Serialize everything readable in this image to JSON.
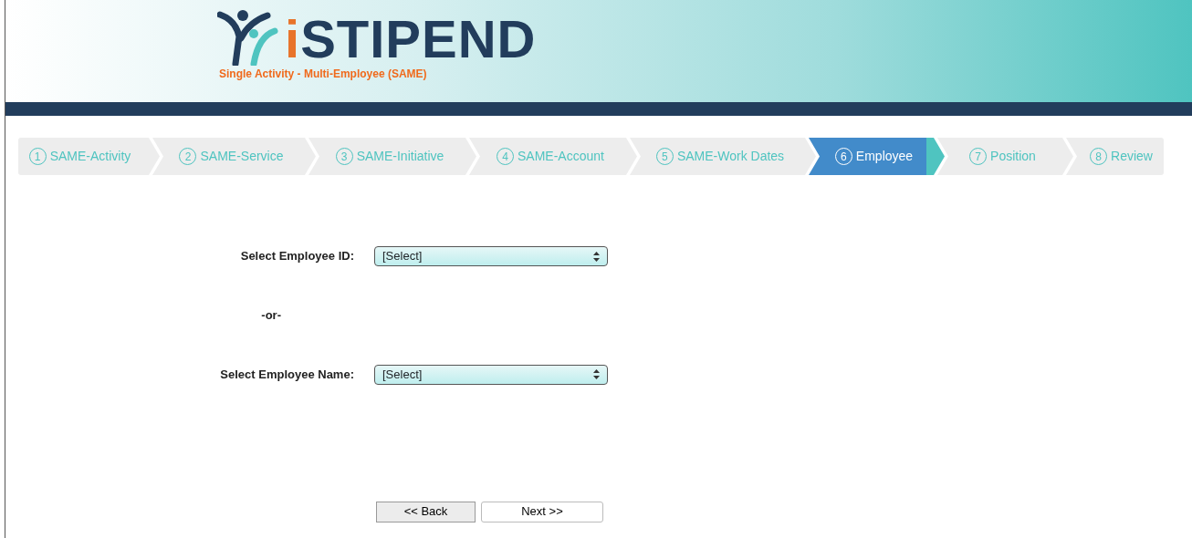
{
  "header": {
    "logo": "iSTIPEND",
    "subtitle": "Single Activity - Multi-Employee (SAME)"
  },
  "steps": [
    {
      "number": "1",
      "label": "SAME-Activity",
      "selected": false
    },
    {
      "number": "2",
      "label": "SAME-Service",
      "selected": false
    },
    {
      "number": "3",
      "label": "SAME-Initiative",
      "selected": false
    },
    {
      "number": "4",
      "label": "SAME-Account",
      "selected": false
    },
    {
      "number": "5",
      "label": "SAME-Work Dates",
      "selected": false
    },
    {
      "number": "6",
      "label": "Employee",
      "selected": true
    },
    {
      "number": "7",
      "label": "Position",
      "selected": false
    },
    {
      "number": "8",
      "label": "Review",
      "selected": false
    }
  ],
  "form": {
    "employee_id": {
      "label": "Select Employee ID:",
      "value": "[Select]"
    },
    "separator": "-or-",
    "employee_name": {
      "label": "Select Employee Name:",
      "value": "[Select]"
    }
  },
  "buttons": [
    {
      "label": "<< Back",
      "kind": "back"
    },
    {
      "label": "Next >>",
      "kind": "next"
    }
  ]
}
